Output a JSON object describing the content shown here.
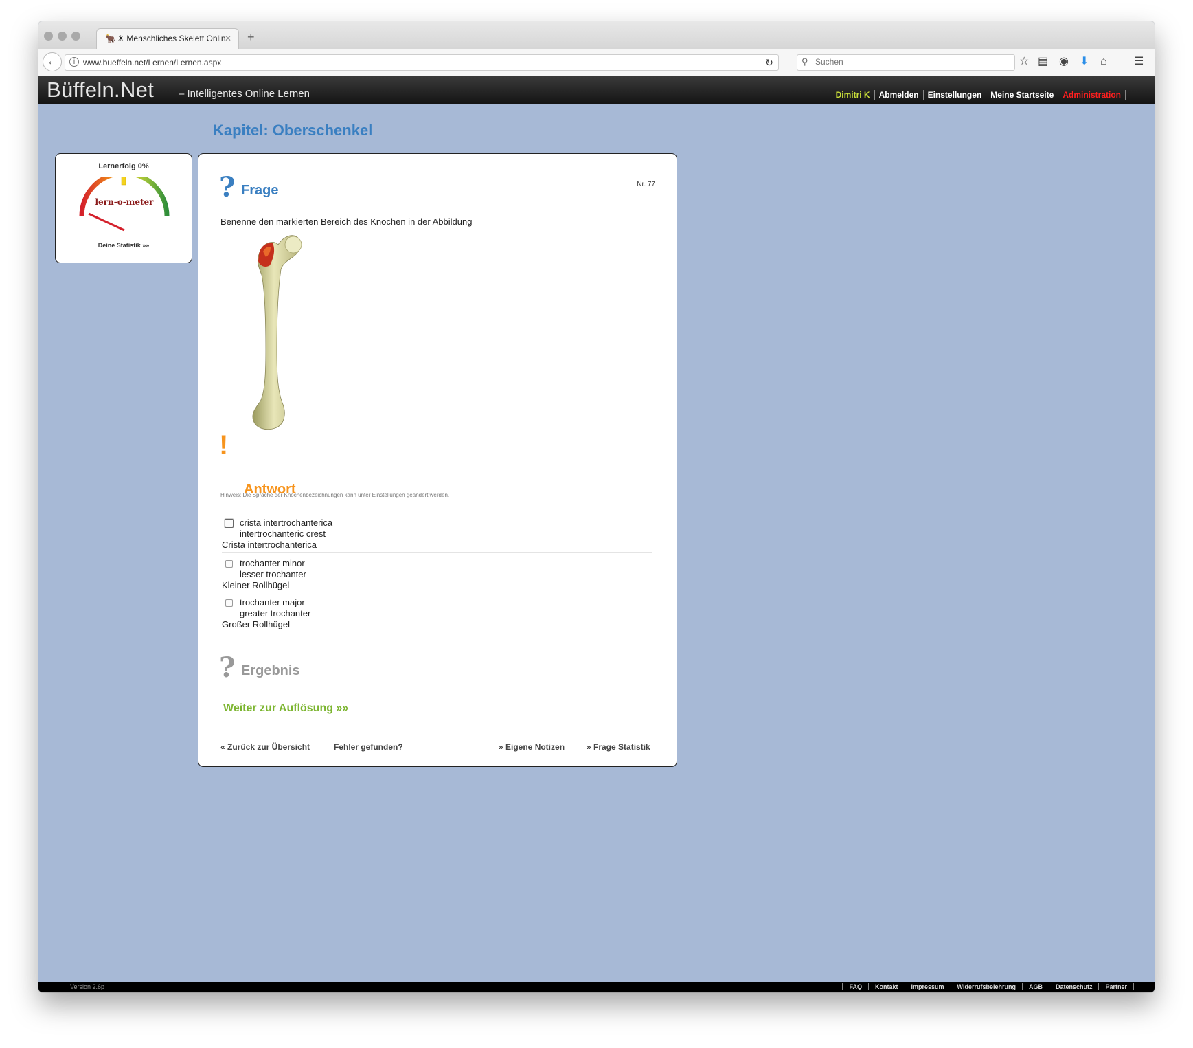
{
  "browser": {
    "tab_title": "☀ Menschliches Skelett Onlin",
    "tab_close": "✕",
    "new_tab": "+",
    "url": "www.bueffeln.net/Lernen/Lernen.aspx",
    "search_placeholder": "Suchen"
  },
  "site": {
    "brand": "Büffeln.Net",
    "tagline": "– Intelligentes Online Lernen",
    "user": "Dimitri K",
    "nav": [
      "Abmelden",
      "Einstellungen",
      "Meine Startseite"
    ],
    "admin": "Administration"
  },
  "chapter": "Kapitel: Oberschenkel",
  "meter": {
    "title": "Lernerfolg 0%",
    "label": "lern-o-meter",
    "link": "Deine Statistik »»",
    "progress_percent": 0
  },
  "question": {
    "icon": "?",
    "heading": "Frage",
    "number": "Nr. 77",
    "text": "Benenne den markierten Bereich des Knochen in der Abbildung"
  },
  "answer": {
    "icon": "!",
    "heading": "Antwort",
    "hint": "Hinweis: Die Sprache der Knochenbezeichnungen kann unter Einstellungen geändert werden.",
    "options": [
      {
        "latin": "crista intertrochanterica",
        "english": "intertrochanteric crest",
        "german": "Crista intertrochanterica"
      },
      {
        "latin": "trochanter minor",
        "english": "lesser trochanter",
        "german": "Kleiner Rollhügel"
      },
      {
        "latin": "trochanter major",
        "english": "greater trochanter",
        "german": "Großer Rollhügel"
      }
    ]
  },
  "result": {
    "icon": "?",
    "heading": "Ergebnis",
    "continue": "Weiter zur Auflösung »»"
  },
  "footer_nav": {
    "back": "« Zurück zur Übersicht",
    "error": "Fehler gefunden?",
    "notes": "» Eigene Notizen",
    "stats": "» Frage Statistik"
  },
  "footer": {
    "version": "Version 2.6p",
    "links": [
      "FAQ",
      "Kontakt",
      "Impressum",
      "Widerrufsbelehrung",
      "AGB",
      "Datenschutz",
      "Partner"
    ]
  },
  "colors": {
    "page_bg": "#a7b9d6",
    "chapter_blue": "#3a7fc1",
    "answer_orange": "#f7941d",
    "result_grey": "#999999",
    "continue_green": "#7cb530",
    "user_yellow": "#c9de3a",
    "admin_red": "#ff1f1f"
  },
  "icons": [
    "back-arrow-icon",
    "info-icon",
    "reload-icon",
    "search-icon",
    "bookmark-star-icon",
    "reading-list-icon",
    "pocket-icon",
    "download-icon",
    "home-icon",
    "menu-icon"
  ]
}
